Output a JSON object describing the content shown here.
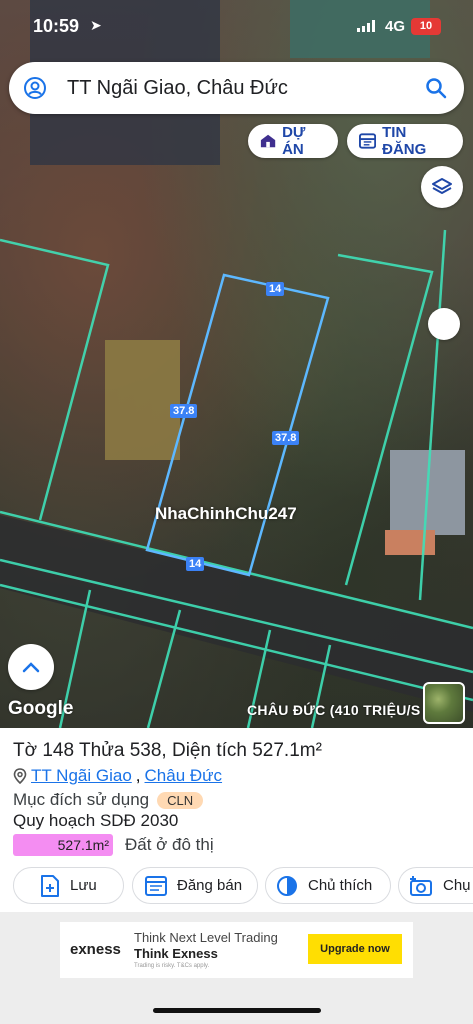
{
  "status_bar": {
    "time": "10:59",
    "network": "4G",
    "battery": "10"
  },
  "search": {
    "title": "TT Ngãi Giao, Châu Đức"
  },
  "chips": {
    "project": "DỰ ÁN",
    "listings": "TIN ĐĂNG"
  },
  "map": {
    "watermark": "NhaChinhChu247",
    "dims": {
      "top": "14",
      "left": "37.8",
      "right": "37.8",
      "bottom": "14"
    },
    "brand": "Google",
    "area_label": "CHÂU ĐỨC (410 TRIỆU/S"
  },
  "parcel": {
    "title": "Tờ 148 Thửa 538, Diện tích 527.1m²",
    "location_town": "TT Ngãi Giao",
    "location_sep": ",",
    "location_district": "Châu Đức",
    "purpose_label": "Mục đích sử dụng",
    "purpose_code": "CLN",
    "plan_label": "Quy hoạch SDĐ 2030",
    "plan_area": "527.1m²",
    "plan_type": "Đất ở đô thị"
  },
  "actions": {
    "save": "Lưu",
    "post": "Đăng bán",
    "theme": "Chủ thích",
    "photo": "Chụ"
  },
  "ad": {
    "brand": "exness",
    "line1": "Think Next Level Trading",
    "line2": "Think Exness",
    "line3": "Trading is risky. T&Cs apply.",
    "cta": "Upgrade now"
  },
  "colors": {
    "accent": "#1a73e8",
    "chip_text": "#1f47a8",
    "parcel_line": "#4fc3f7",
    "plan_bar": "#f48df2"
  }
}
